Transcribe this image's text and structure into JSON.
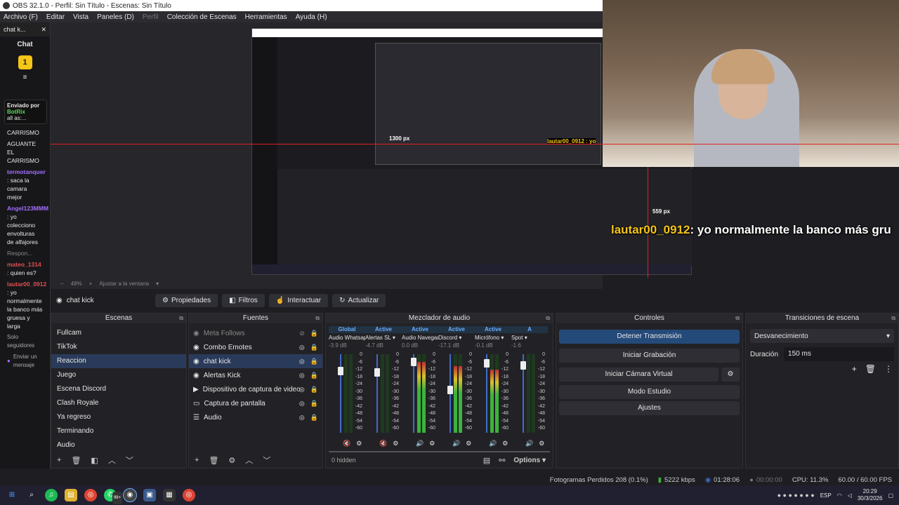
{
  "window": {
    "title": "OBS 32.1.0 - Perfil: Sin Título - Escenas: Sin Título"
  },
  "menu": [
    {
      "label": "Archivo (F)",
      "enabled": true
    },
    {
      "label": "Editar",
      "enabled": true
    },
    {
      "label": "Vista",
      "enabled": true
    },
    {
      "label": "Paneles (D)",
      "enabled": true
    },
    {
      "label": "Perfil",
      "enabled": false
    },
    {
      "label": "Colección de Escenas",
      "enabled": true
    },
    {
      "label": "Herramientas",
      "enabled": true
    },
    {
      "label": "Ayuda (H)",
      "enabled": true
    }
  ],
  "chat": {
    "tab_label": "chat k...",
    "title": "Chat",
    "badge": "1",
    "sent_by_label": "Enviado por",
    "sent_by_user": "BotRix",
    "sent_by_text": "all as:...",
    "messages": [
      {
        "user": "",
        "text": "CARRISMO"
      },
      {
        "user": "",
        "text": "AGUANTE EL CARRISMO"
      },
      {
        "user": "termotanquer",
        "text": ": saca la camara mejor"
      },
      {
        "user": "Angel123MMM",
        "text": ": yo colecciono envolturas de alfajores"
      },
      {
        "user": "Respon...",
        "text": ""
      },
      {
        "user": "mateo_1314",
        "text": ": quien es?"
      },
      {
        "user": "lautar00_0912",
        "text": ": yo normalmente la banco más gruesa y larga"
      }
    ],
    "followers_only": "Solo seguidores",
    "send_placeholder": "Enviar un mensaje"
  },
  "preview": {
    "zoom": "48%",
    "fit_label": "Ajustar a la ventana",
    "overlay_user": "lautar00_0912",
    "overlay_text": ": yo normalmente la banco más gru",
    "nested_measure_1": "1300 px",
    "nested_measure_2": "559 px",
    "nested_overlay": "lautar00_0912 : yo"
  },
  "source_toolbar": {
    "current_source": "chat kick",
    "buttons": [
      "Propiedades",
      "Filtros",
      "Interactuar",
      "Actualizar"
    ]
  },
  "scenes": {
    "title": "Escenas",
    "items": [
      "Fullcam",
      "TikTok",
      "Reaccion",
      "Juego",
      "Escena Discord",
      "Clash Royale",
      "Ya regreso",
      "Terminando",
      "Audio"
    ],
    "selected": 2
  },
  "sources": {
    "title": "Fuentes",
    "items": [
      {
        "name": "Meta Follows",
        "icon": "browser-icon",
        "visible": false
      },
      {
        "name": "Combo Emotes",
        "icon": "browser-icon",
        "visible": true
      },
      {
        "name": "chat kick",
        "icon": "browser-icon",
        "visible": true
      },
      {
        "name": "Alertas Kick",
        "icon": "browser-icon",
        "visible": true
      },
      {
        "name": "Dispositivo de captura de video",
        "icon": "camera-icon",
        "visible": true
      },
      {
        "name": "Captura de pantalla",
        "icon": "monitor-icon",
        "visible": true
      },
      {
        "name": "Audio",
        "icon": "list-icon",
        "visible": true
      }
    ],
    "selected": 2
  },
  "mixer": {
    "title": "Mezclador de audio",
    "hidden_label": "0 hidden",
    "options_label": "Options",
    "channels": [
      {
        "status": "Global",
        "name": "Audio Whatsapp",
        "db": "-3.9 dB",
        "level": 0.0,
        "fader": 0.82,
        "muted": true
      },
      {
        "status": "Active",
        "name": "Alertas SL",
        "db": "-4.7 dB",
        "level": 0.0,
        "fader": 0.8,
        "muted": true
      },
      {
        "status": "Active",
        "name": "Audio Navegado",
        "db": "0.0 dB",
        "level": 0.9,
        "fader": 0.95,
        "muted": false
      },
      {
        "status": "Active",
        "name": "Discord",
        "db": "-17.1 dB",
        "level": 0.85,
        "fader": 0.55,
        "muted": false
      },
      {
        "status": "Active",
        "name": "Micrófono",
        "db": "-0.1 dB",
        "level": 0.8,
        "fader": 0.93,
        "muted": false
      },
      {
        "status": "A",
        "name": "Spot",
        "db": "-1.6",
        "level": 0.0,
        "fader": 0.9,
        "muted": false
      }
    ],
    "scale": [
      "0",
      "-6",
      "-12",
      "-18",
      "-24",
      "-30",
      "-36",
      "-42",
      "-48",
      "-54",
      "-60"
    ]
  },
  "controls": {
    "title": "Controles",
    "stop_stream": "Detener Transmisión",
    "start_recording": "Iniciar Grabación",
    "start_virtualcam": "Iniciar Cámara Virtual",
    "studio_mode": "Modo Estudio",
    "settings": "Ajustes"
  },
  "transitions": {
    "title": "Transiciones de escena",
    "selected": "Desvanecimiento",
    "duration_label": "Duración",
    "duration_value": "150 ms"
  },
  "status": {
    "dropped_frames": "Fotogramas Perdidos 208 (0.1%)",
    "bitrate": "5222 kbps",
    "stream_time": "01:28:06",
    "record_time": "00:00:00",
    "cpu": "CPU: 11.3%",
    "fps": "60.00 / 60.00 FPS"
  },
  "taskbar": {
    "lang": "ESP",
    "time": "20:29",
    "date": "30/3/2026",
    "badge": "99+"
  },
  "colors": {
    "accent": "#3f6cc8",
    "selection": "#2a3a5a",
    "mixer_active": "#6ab0ff",
    "user_purple": "#a46cff",
    "user_red": "#e05050"
  }
}
